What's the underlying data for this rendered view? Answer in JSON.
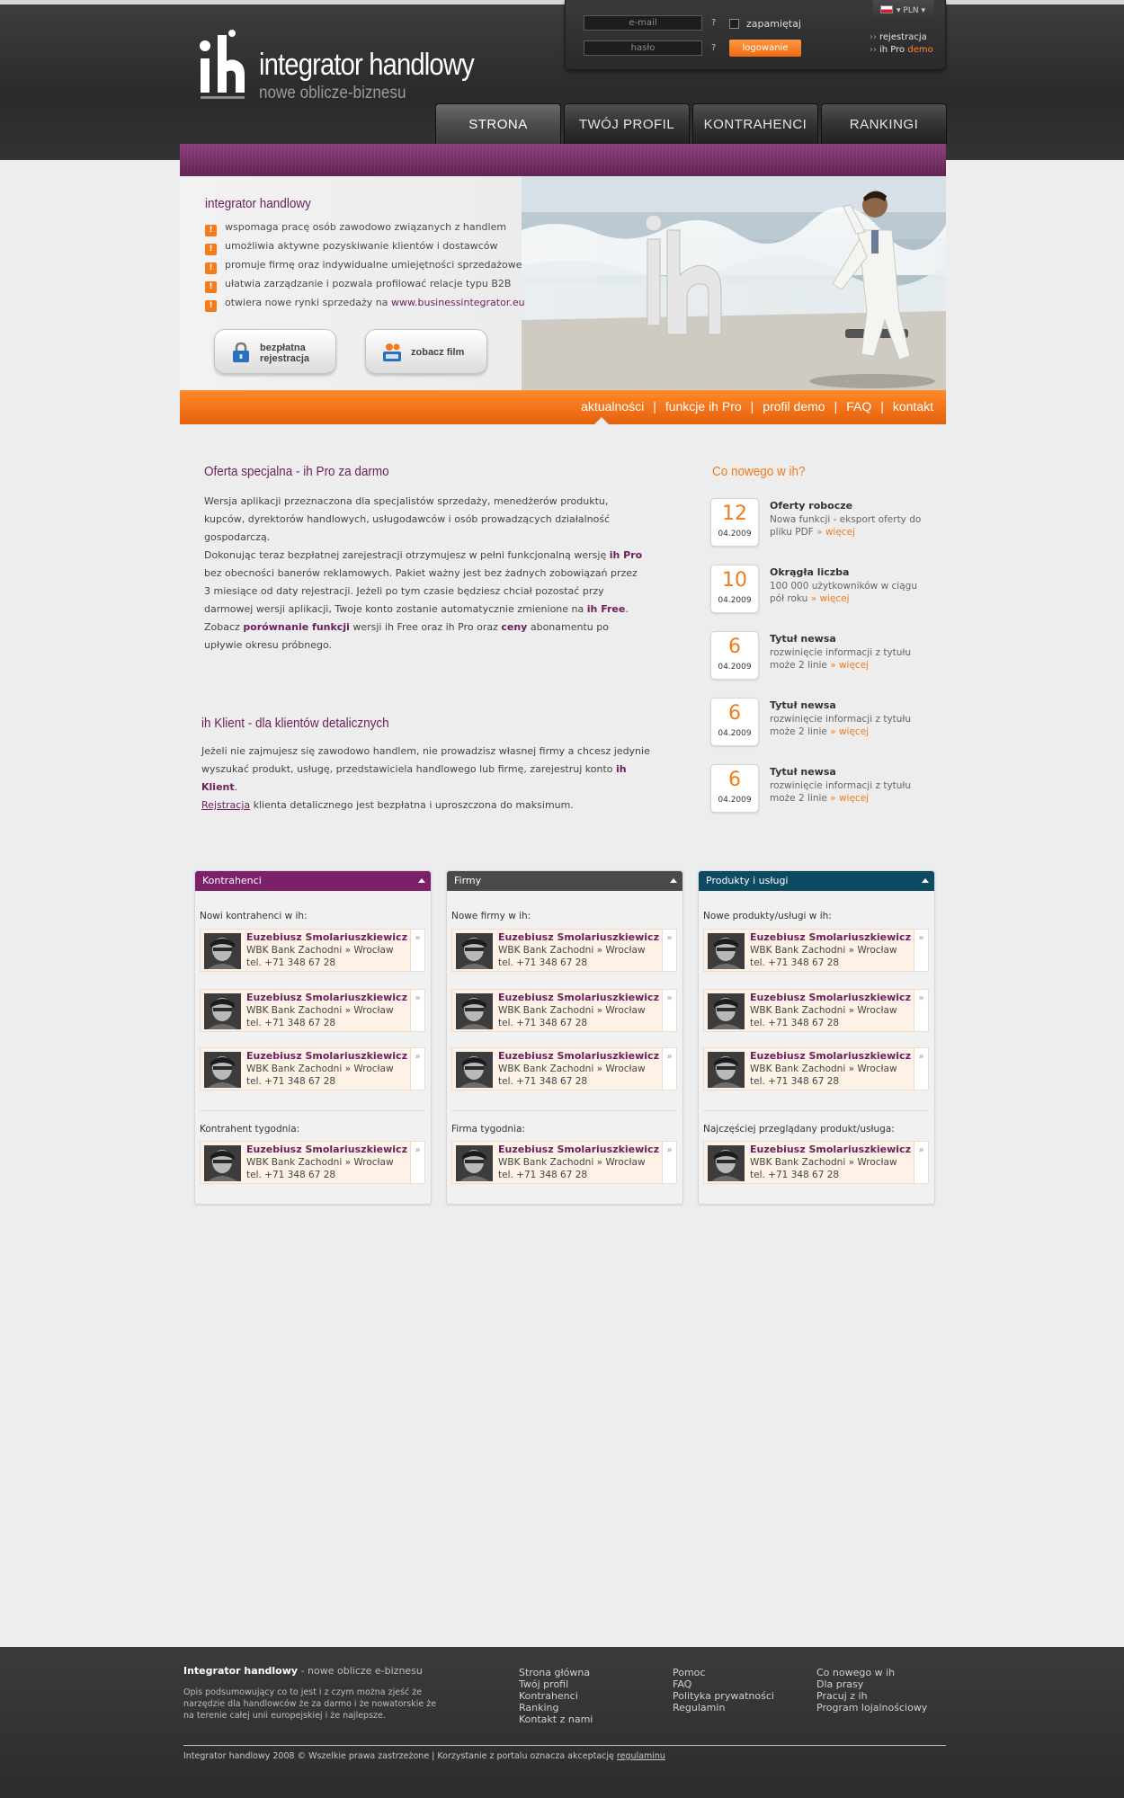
{
  "brand": {
    "name": "integrator handlowy",
    "tagline": "nowe oblicze-biznesu"
  },
  "login": {
    "email_placeholder": "e-mail",
    "password_placeholder": "hasło",
    "help_mark": "?",
    "remember_label": "zapamiętaj",
    "login_button": "logowanie",
    "currency": "PLN",
    "links": {
      "register": "rejestracja",
      "ihpro_prefix": "ih Pro",
      "demo": "demo"
    }
  },
  "nav": {
    "tabs": [
      "STRONA GŁÓWNA",
      "TWÓJ PROFIL",
      "KONTRAHENCI",
      "RANKINGI"
    ],
    "active": "STRONA GŁÓWNA"
  },
  "hero": {
    "title": "integrator handlowy",
    "bullets": [
      "wspomaga pracę osób zawodowo związanych z handlem",
      "umożliwia aktywne pozyskiwanie klientów i dostawców",
      "promuje firmę oraz indywidualne umiejętności sprzedażowe",
      "ułatwia zarządzanie i pozwala profilować relacje typu B2B",
      "otwiera nowe rynki sprzedaży na"
    ],
    "bullet_link": "www.businessintegrator.eu",
    "buttons": {
      "register_line1": "bezpłatna",
      "register_line2": "rejestracja",
      "film": "zobacz film"
    }
  },
  "subnav": {
    "items": [
      "aktualności",
      "funkcje ih Pro",
      "profil demo",
      "FAQ",
      "kontakt"
    ],
    "separator": "|"
  },
  "offer": {
    "title": "Oferta specjalna - ih Pro za darmo",
    "p1": "Wersja aplikacji przeznaczona dla specjalistów sprzedaży, menedżerów produktu, kupców, dyrektorów handlowych, usługodawców i osób prowadzących działalność gospodarczą.",
    "p2_a": "Dokonując teraz bezpłatnej zarejestracji otrzymujesz w pełni funkcjonalną wersję",
    "p2_b": "ih Pro",
    "p2_c": "bez obecności banerów reklamowych. Pakiet ważny jest bez żadnych zobowiązań przez 3 miesiące od daty rejestracji. Jeżeli po tym czasie będziesz chciał pozostać przy darmowej  wersji aplikacji, Twoje konto zostanie automatycznie zmienione na",
    "p2_d": "ih Free",
    "p3_a": "Zobacz",
    "p3_b": "porównanie funkcji",
    "p3_c": "wersji ih Free oraz ih Pro oraz",
    "p3_d": "ceny",
    "p3_e": "abonamentu po upływie okresu próbnego."
  },
  "klient": {
    "title": "ih Klient - dla klientów detalicznych",
    "text_a": "Jeżeli nie zajmujesz się zawodowo handlem, nie prowadzisz własnej firmy a chcesz jedynie  wyszukać produkt, usługę, przedstawiciela handlowego lub firmę, zarejestruj konto",
    "text_b": "ih Klient",
    "link": "Rejstracja",
    "text_c": "klienta detalicznego jest bezpłatna i uproszczona do maksimum."
  },
  "news": {
    "title": "Co nowego w ih?",
    "items": [
      {
        "day": "12",
        "month": "04.2009",
        "head": "Oferty robocze",
        "body": "Nowa funkcji - eksport oferty do pliku PDF",
        "more": "» więcej"
      },
      {
        "day": "10",
        "month": "04.2009",
        "head": "Okrągła liczba",
        "body": "100 000 użytkowników w ciągu pół roku",
        "more": "» więcej"
      },
      {
        "day": "6",
        "month": "04.2009",
        "head": "Tytuł newsa",
        "body": "rozwinięcie informacji z tytułu może 2 linie",
        "more": "» więcej"
      },
      {
        "day": "6",
        "month": "04.2009",
        "head": "Tytuł newsa",
        "body": "rozwinięcie informacji z tytułu może 2 linie",
        "more": "» więcej"
      },
      {
        "day": "6",
        "month": "04.2009",
        "head": "Tytuł newsa",
        "body": "rozwinięcie informacji z tytułu może 2 linie",
        "more": "» więcej"
      }
    ]
  },
  "card": {
    "name": "Euzebiusz Smolariuszkiewicz",
    "company": "WBK Bank Zachodni » Wrocław",
    "phone": "tel. +71 348 67 28",
    "arrow": "»"
  },
  "panels": [
    {
      "title": "Kontrahenci",
      "color": "#7b2069",
      "list_label": "Nowi kontrahenci w ih:",
      "featured_label": "Kontrahent tygodnia:"
    },
    {
      "title": "Firmy",
      "color": "#4a4a4a",
      "list_label": "Nowe firmy w ih:",
      "featured_label": "Firma tygodnia:"
    },
    {
      "title": "Produkty i usługi",
      "color": "#0d4b63",
      "list_label": "Nowe produkty/usługi w ih:",
      "featured_label": "Najczęściej przeglądany produkt/usługa:"
    }
  ],
  "footer": {
    "brand": "Integrator handlowy",
    "brand_tag": "- nowe oblicze e-biznesu",
    "desc": "Opis podsumowujący co to jest i z czym można zjeść że narzędzie dla handlowców że za darmo i że nowatorskie że na terenie całej unii europejskiej i że najlepsze.",
    "col1": [
      "Strona główna",
      "Twój profil",
      "Kontrahenci",
      "Ranking",
      "Kontakt z nami"
    ],
    "col2": [
      "Pomoc",
      "FAQ",
      "Polityka prywatności",
      "Regulamin"
    ],
    "col3": [
      "Co nowego w ih",
      "Dla prasy",
      "Pracuj z ih",
      "Program lojalnościowy"
    ],
    "copyright": "Integrator handlowy 2008 © Wszelkie prawa zastrzeżone  |  Korzystanie z portalu oznacza akceptację",
    "copyright_link": "regulaminu"
  }
}
